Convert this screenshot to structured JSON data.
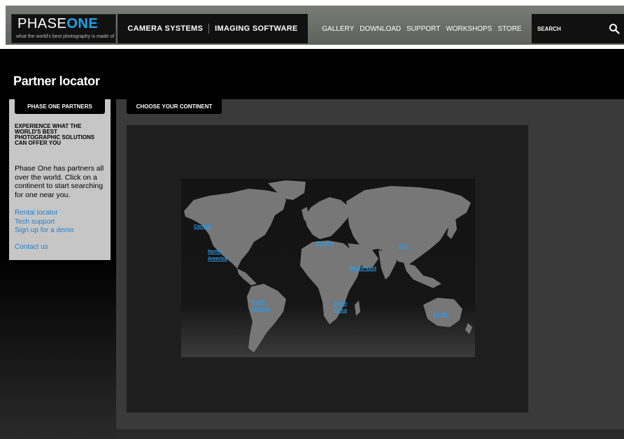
{
  "header": {
    "logo": {
      "word_a": "PHASE",
      "word_b": "ONE",
      "tagline": "what the world's best photography is made of"
    },
    "main_nav": [
      {
        "bold": "CAMERA ",
        "label": "SYSTEMS"
      },
      {
        "bold": "IMAGING ",
        "label": "SOFTWARE"
      }
    ],
    "sub_nav": [
      "GALLERY",
      "DOWNLOAD",
      "SUPPORT",
      "WORKSHOPS",
      "STORE"
    ],
    "search": {
      "placeholder": "SEARCH",
      "icon": "search-icon"
    }
  },
  "page_title": "Partner locator",
  "sidebar": {
    "tab": "PHASE ONE PARTNERS",
    "heading": "EXPERIENCE WHAT THE WORLD'S BEST PHOTOGRAPHIC SOLUTIONS CAN OFFER YOU",
    "text": "Phase One has partners all over the world. Click on a continent to start searching for one near you.",
    "links": [
      "Rental locator",
      "Tech support",
      "Sign up for a demo"
    ],
    "contact": "Contact us"
  },
  "main": {
    "tab": "CHOOSE YOUR CONTINENT",
    "regions": {
      "canada": "Canada",
      "north_america": [
        "North",
        "America"
      ],
      "europe": "Europe",
      "asia": "Asia",
      "middle_east": "Middle East",
      "south_america": [
        "South",
        "America"
      ],
      "south_africa": [
        "South",
        "Africa"
      ],
      "pacific": "Pacific"
    }
  },
  "colors": {
    "accent": "#1ea3e6",
    "link": "#1f7fd0",
    "land": "#777777"
  }
}
